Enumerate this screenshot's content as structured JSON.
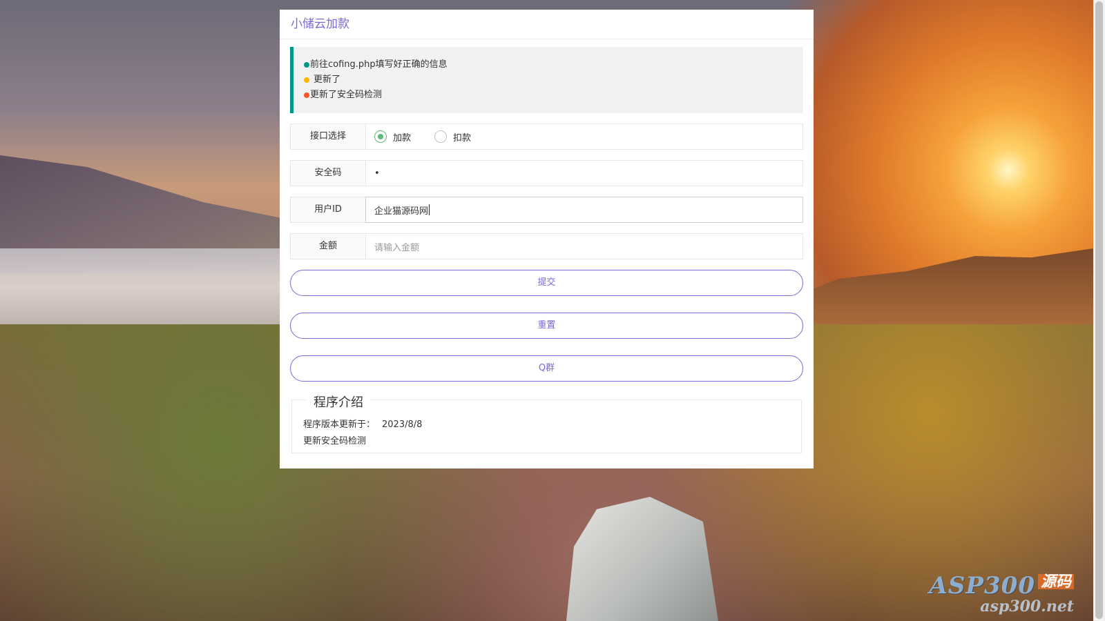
{
  "panel": {
    "title": "小储云加款"
  },
  "notice": {
    "lines": [
      "前往cofing.php填写好正确的信息",
      "更新了",
      "更新了安全码检测"
    ],
    "dot_colors": [
      "#009688",
      "#ffb800",
      "#ff5722"
    ]
  },
  "form": {
    "interface": {
      "label": "接口选择",
      "options": [
        "加款",
        "扣款"
      ],
      "selected": "加款"
    },
    "security_code": {
      "label": "安全码",
      "value": "•"
    },
    "user_id": {
      "label": "用户ID",
      "value": "企业猫源码网"
    },
    "amount": {
      "label": "金额",
      "placeholder": "请输入金额"
    }
  },
  "buttons": {
    "submit": "提交",
    "reset": "重置",
    "qgroup": "Q群"
  },
  "intro": {
    "legend": "程序介绍",
    "version_label": "程序版本更新于：",
    "version_date": "2023/8/8",
    "note": "更新安全码检测"
  },
  "watermark": {
    "main": "ASP300",
    "tag": "源码",
    "sub": "asp300.net"
  },
  "colors": {
    "accent": "#7a6ad8",
    "notice_border": "#009688",
    "radio_checked": "#5fb878"
  }
}
